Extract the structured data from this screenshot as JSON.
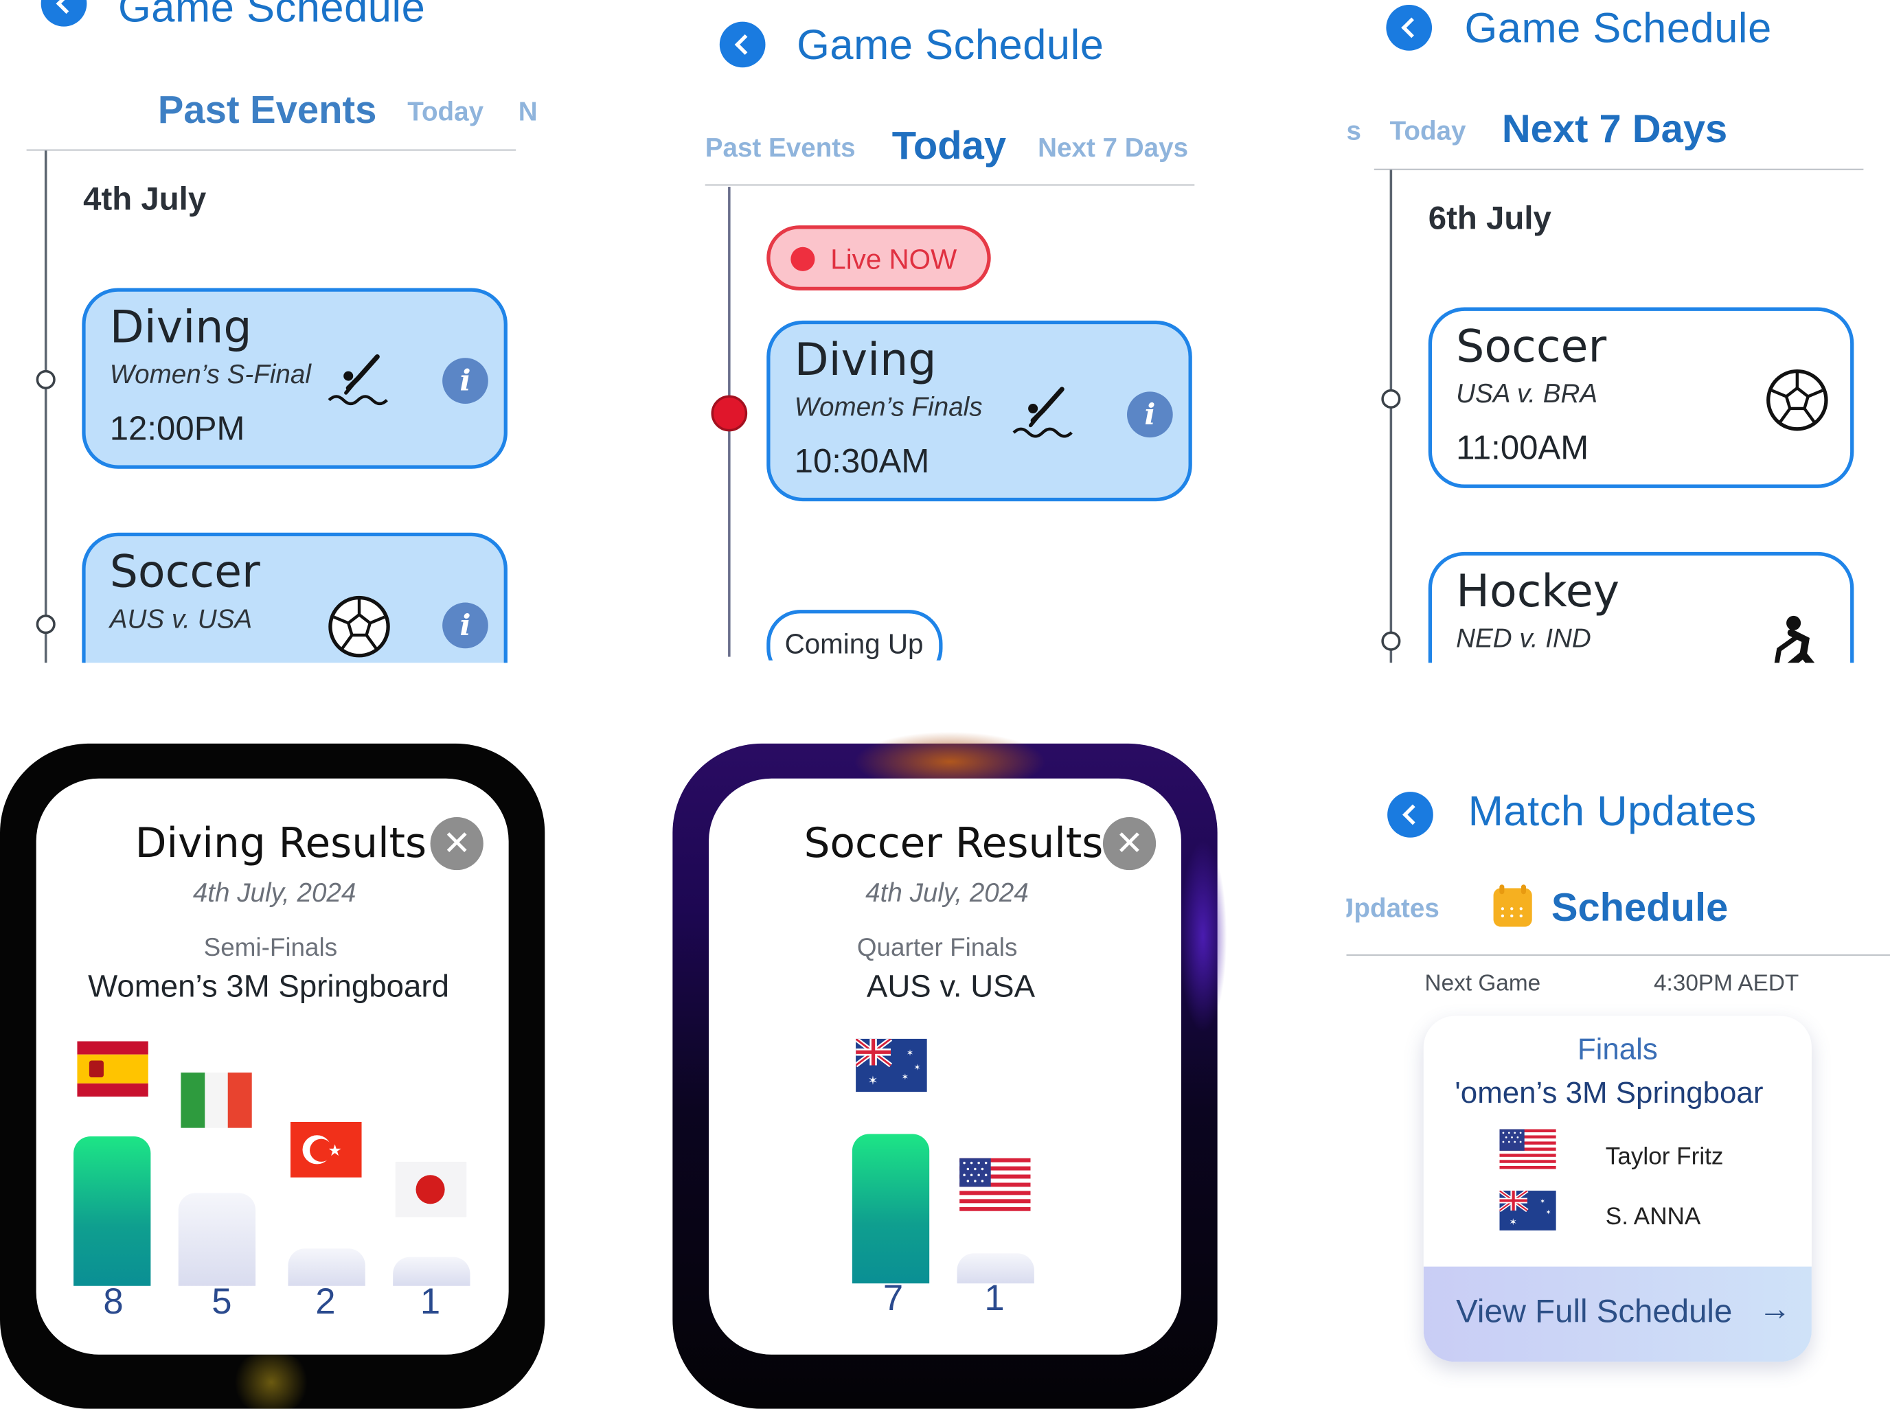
{
  "panel1": {
    "title": "Game Schedule",
    "tabs": [
      "Past Events",
      "Today",
      "N"
    ],
    "date": "4th July",
    "cards": [
      {
        "title": "Diving",
        "subtitle": "Women’s S-Final",
        "time": "12:00PM",
        "icon": "diving-icon"
      },
      {
        "title": "Soccer",
        "subtitle": "AUS v. USA",
        "time": "",
        "icon": "soccer-ball-icon"
      }
    ],
    "info_glyph": "i"
  },
  "panel2": {
    "title": "Game Schedule",
    "tabs": [
      "Past Events",
      "Today",
      "Next 7 Days"
    ],
    "live_label": "Live NOW",
    "card": {
      "title": "Diving",
      "subtitle": "Women’s Finals",
      "time": "10:30AM",
      "icon": "diving-icon"
    },
    "coming_up": "Coming Up",
    "info_glyph": "i"
  },
  "panel3": {
    "title": "Game Schedule",
    "tabs": [
      "s",
      "Today",
      "Next 7 Days"
    ],
    "date": "6th July",
    "cards": [
      {
        "title": "Soccer",
        "subtitle": "USA v. BRA",
        "time": "11:00AM",
        "icon": "soccer-ball-icon"
      },
      {
        "title": "Hockey",
        "subtitle": "NED v. IND",
        "time": "",
        "icon": "hockey-player-icon"
      }
    ]
  },
  "diving_results": {
    "title": "Diving Results",
    "close_glyph": "✕",
    "date": "4th July, 2024",
    "round": "Semi-Finals",
    "event": "Women’s 3M Springboard",
    "entries": [
      {
        "country": "Spain",
        "flag": "flag-spain-icon",
        "score": "8",
        "value": 8
      },
      {
        "country": "Italy",
        "flag": "flag-italy-icon",
        "score": "5",
        "value": 5
      },
      {
        "country": "Turkey",
        "flag": "flag-turkey-icon",
        "score": "2",
        "value": 2
      },
      {
        "country": "Japan",
        "flag": "flag-japan-icon",
        "score": "1",
        "value": 1
      }
    ]
  },
  "soccer_results": {
    "title": "Soccer Results",
    "close_glyph": "✕",
    "date": "4th July, 2024",
    "round": "Quarter Finals",
    "event": "AUS v. USA",
    "entries": [
      {
        "country": "Australia",
        "flag": "flag-australia-icon",
        "score": "7",
        "value": 7
      },
      {
        "country": "USA",
        "flag": "flag-usa-icon",
        "score": "1",
        "value": 1
      }
    ]
  },
  "match_updates": {
    "title": "Match Updates",
    "tabs": [
      "Jpdates",
      "Schedule"
    ],
    "next_game_label": "Next Game",
    "next_game_time": "4:30PM AEDT",
    "card": {
      "round": "Finals",
      "event": "'omen’s 3M Springboar",
      "players": [
        {
          "name": "Taylor Fritz",
          "flag": "flag-usa-icon"
        },
        {
          "name": "S. ANNA",
          "flag": "flag-australia-icon"
        }
      ],
      "cta": "View Full Schedule",
      "cta_arrow": "→"
    }
  },
  "colors": {
    "accent": "#1a73c9",
    "card_fill": "#bfdffb",
    "card_border": "#1f84e8",
    "live_red": "#e0162b",
    "win_bar_top": "#1de586",
    "win_bar_bottom": "#0a8f94"
  }
}
